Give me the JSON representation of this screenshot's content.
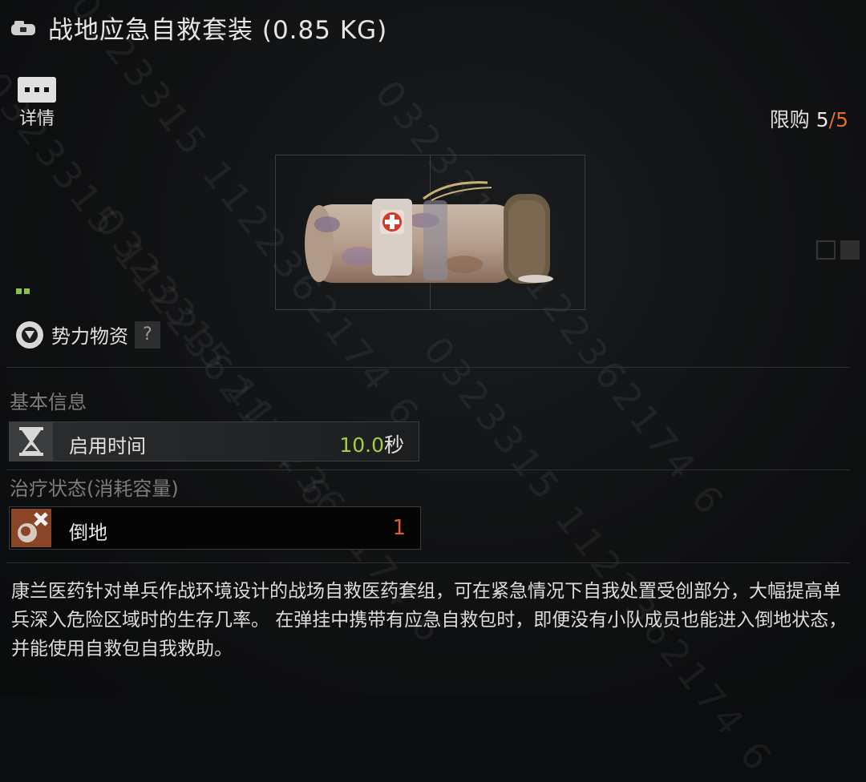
{
  "header": {
    "icon": "toolbox-icon",
    "title": "战地应急自救套装 (0.85 KG)"
  },
  "detail": {
    "icon": "dots-menu-icon",
    "label": "详情"
  },
  "purchase_limit": {
    "label": "限购",
    "current": "5",
    "separator": "/",
    "max": "5"
  },
  "faction": {
    "icon": "faction-shield-icon",
    "label": "势力物资",
    "help_label": "?"
  },
  "basic_info": {
    "title": "基本信息",
    "use_time": {
      "icon": "hourglass-icon",
      "label": "启用时间",
      "value": "10.0",
      "unit": "秒"
    }
  },
  "treatment": {
    "title": "治疗状态(消耗容量)",
    "downed": {
      "icon": "downed-status-icon",
      "label": "倒地",
      "value": "1"
    }
  },
  "description": "康兰医药针对单兵作战环境设计的战场自救医药套组，可在紧急情况下自我处置受创部分，大幅提高单兵深入危险区域时的生存几率。 在弹挂中携带有应急自救包时，即便没有小队成员也能进入倒地状态，并能使用自救包自我救助。",
  "watermark": "0323315 1122362174 6",
  "colors": {
    "accent_green": "#a6cf3a",
    "accent_orange": "#e25a2a",
    "limit_orange": "#e26a2c"
  }
}
